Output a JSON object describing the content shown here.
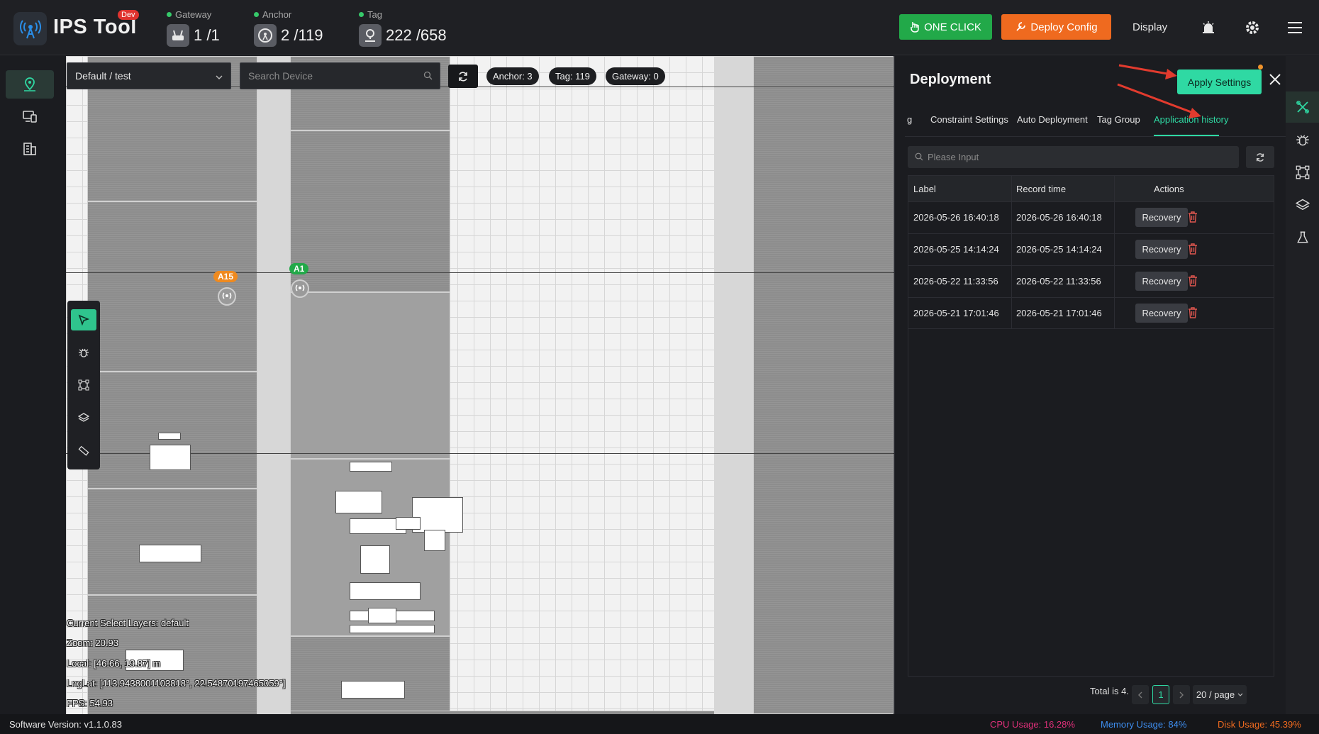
{
  "header": {
    "app_title": "IPS Tool",
    "badge": "Dev",
    "stats": [
      {
        "label": "Gateway",
        "value": "1 /1",
        "icon": "router-icon"
      },
      {
        "label": "Anchor",
        "value": "2 /119",
        "icon": "anchor-icon"
      },
      {
        "label": "Tag",
        "value": "222 /658",
        "icon": "tag-icon"
      }
    ],
    "one_click_label": "ONE CLICK",
    "deploy_label": "Deploy Config",
    "display_label": "Display",
    "colors": {
      "one_click": "#22a949",
      "deploy": "#ef6a1f",
      "accent": "#2fd9a3"
    }
  },
  "map": {
    "layer_select": "Default / test",
    "search_placeholder": "Search Device",
    "pills": [
      "Anchor: 3",
      "Tag: 119",
      "Gateway: 0"
    ],
    "anchors": [
      {
        "label": "A15",
        "color": "#ef8a1f"
      },
      {
        "label": "A1",
        "color": "#22a949"
      }
    ],
    "info": {
      "layers": "Current Select Layers:  default",
      "zoom": "Zoom:  20.93",
      "local": "Local:  [46.66, 19.87] m",
      "lnglat": "LngLat:  [113.9438001103818°, 22.54870197465059°]",
      "fps": "FPS:  54.93"
    }
  },
  "panel": {
    "title": "Deployment",
    "apply_label": "Apply Settings",
    "tabs": [
      "g",
      "Constraint Settings",
      "Auto Deployment",
      "Tag Group",
      "Application history"
    ],
    "active_tab": "Application history",
    "search_placeholder": "Please Input",
    "columns": [
      "Label",
      "Record time",
      "Actions"
    ],
    "rows": [
      {
        "label": "2026-05-26 16:40:18",
        "time": "2026-05-26 16:40:18",
        "action": "Recovery"
      },
      {
        "label": "2026-05-25 14:14:24",
        "time": "2026-05-25 14:14:24",
        "action": "Recovery"
      },
      {
        "label": "2026-05-22 11:33:56",
        "time": "2026-05-22 11:33:56",
        "action": "Recovery"
      },
      {
        "label": "2026-05-21 17:01:46",
        "time": "2026-05-21 17:01:46",
        "action": "Recovery"
      }
    ],
    "pagination": {
      "total": "Total is 4.",
      "page": "1",
      "page_size": "20 / page"
    }
  },
  "status": {
    "version": "Software Version:  v1.1.0.83",
    "cpu": "CPU Usage:  16.28%",
    "memory": "Memory Usage:  84%",
    "disk": "Disk Usage:  45.39%"
  }
}
